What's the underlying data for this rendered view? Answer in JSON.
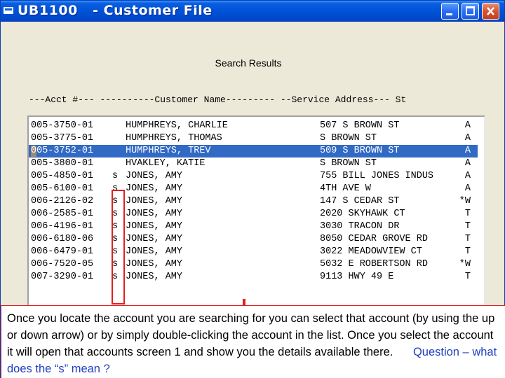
{
  "window": {
    "title": "UB1100   - Customer File",
    "min_label": "_"
  },
  "search": {
    "title": "Search Results",
    "column_header": "---Acct #--- ----------Customer Name--------- --Service Address--- St"
  },
  "results": [
    {
      "acct": "005-3750-01",
      "flag": "",
      "name": "HUMPHREYS, CHARLIE",
      "address": "507 S BROWN ST",
      "st": "A"
    },
    {
      "acct": "005-3775-01",
      "flag": "",
      "name": "HUMPHREYS, THOMAS",
      "address": "S BROWN ST",
      "st": "A"
    },
    {
      "acct": "005-3752-01",
      "flag": "",
      "name": "HUMPHREYS, TREV",
      "address": "509 S BROWN ST",
      "st": "A",
      "selected": true
    },
    {
      "acct": "005-3800-01",
      "flag": "",
      "name": "HVAKLEY, KATIE",
      "address": "S BROWN ST",
      "st": "A"
    },
    {
      "acct": "005-4850-01",
      "flag": "s",
      "name": "JONES, AMY",
      "address": "755 BILL JONES INDUS",
      "st": "A"
    },
    {
      "acct": "005-6100-01",
      "flag": "s",
      "name": "JONES, AMY",
      "address": "4TH AVE W",
      "st": "A"
    },
    {
      "acct": "006-2126-02",
      "flag": "s",
      "name": "JONES, AMY",
      "address": "147 S CEDAR ST",
      "st": "*W"
    },
    {
      "acct": "006-2585-01",
      "flag": "s",
      "name": "JONES, AMY",
      "address": "2020 SKYHAWK CT",
      "st": "T"
    },
    {
      "acct": "006-4196-01",
      "flag": "s",
      "name": "JONES, AMY",
      "address": "3030 TRACON DR",
      "st": "T"
    },
    {
      "acct": "006-6180-06",
      "flag": "s",
      "name": "JONES, AMY",
      "address": "8050 CEDAR GROVE RD",
      "st": "T"
    },
    {
      "acct": "006-6479-01",
      "flag": "s",
      "name": "JONES, AMY",
      "address": "3022 MEADOWVIEW CT",
      "st": "T"
    },
    {
      "acct": "006-7520-05",
      "flag": "s",
      "name": "JONES, AMY",
      "address": "5032 E ROBERTSON RD",
      "st": "*W"
    },
    {
      "acct": "007-3290-01",
      "flag": "s",
      "name": "JONES, AMY",
      "address": "9113 HWY 49 E",
      "st": "T"
    }
  ],
  "callout": {
    "text": "Once you locate the account you are searching for you can select that account (by using the up or down arrow) or by simply double-clicking the account in the list. Once you select the account it will open that accounts screen 1 and show you the details available there.",
    "question": "Question – what does the “s” mean ?"
  },
  "colors": {
    "titlebar": "#0052d6",
    "selection": "#316ac5",
    "highlight_box": "#e02020",
    "question_text": "#1f3fbf"
  }
}
